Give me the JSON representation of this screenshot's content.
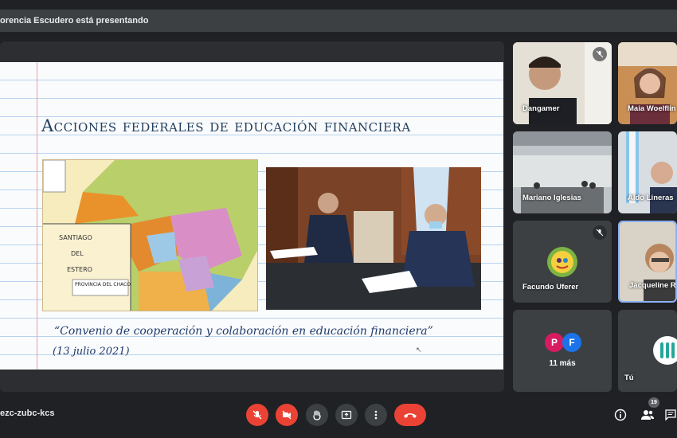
{
  "banner": {
    "presenter_text": "orencia Escudero está presentando"
  },
  "slide": {
    "title": "Acciones federales de educación financiera",
    "caption": "“Convenio de cooperación y colaboración en educación financiera”",
    "date": "(13 julio 2021)",
    "map_label": "PROVINCIA DEL CHACO"
  },
  "participants": [
    {
      "name": "Dangamer",
      "muted": true
    },
    {
      "name": "Maia Woelflin",
      "muted": false
    },
    {
      "name": "Mariano Iglesias",
      "muted": false
    },
    {
      "name": "Aldo Lineras",
      "muted": false
    },
    {
      "name": "Facundo Uferer",
      "muted": true
    },
    {
      "name": "Jacqueline R",
      "muted": false
    }
  ],
  "more_tile": {
    "label": "11 más",
    "initials": [
      "P",
      "F"
    ]
  },
  "self_tile": {
    "label": "Tú"
  },
  "bottom": {
    "meeting_code": "ezc-zubc-kcs",
    "participant_count": "19"
  },
  "colors": {
    "end_call": "#ea4335",
    "avatar_p": "#d81b60",
    "avatar_f": "#1a73e8"
  }
}
